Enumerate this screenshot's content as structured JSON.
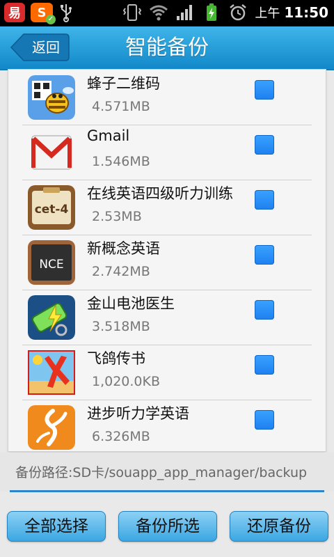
{
  "status_bar": {
    "left_icons": [
      "app-notification-icon",
      "sogou-input-icon",
      "usb-icon"
    ],
    "app1_glyph": "易",
    "app2_glyph": "S",
    "right_icons": [
      "vibrate-icon",
      "wifi-icon",
      "signal-icon",
      "battery-charging-icon",
      "alarm-icon"
    ],
    "ampm": "上午",
    "time": "11:50"
  },
  "header": {
    "back_label": "返回",
    "title": "智能备份"
  },
  "apps": [
    {
      "name": "蜂子二维码",
      "size": "4.571MB",
      "icon": "bee-qr-icon",
      "checked": true
    },
    {
      "name": "Gmail",
      "size": "1.546MB",
      "icon": "gmail-icon",
      "checked": true
    },
    {
      "name": "在线英语四级听力训练",
      "size": "2.53MB",
      "icon": "cet4-icon",
      "icon_text": "cet-4",
      "checked": true
    },
    {
      "name": "新概念英语",
      "size": "2.742MB",
      "icon": "nce-icon",
      "icon_text": "NCE",
      "checked": true
    },
    {
      "name": "金山电池医生",
      "size": "3.518MB",
      "icon": "battery-doctor-icon",
      "checked": true
    },
    {
      "name": "飞鸽传书",
      "size": "1,020.0KB",
      "icon": "feige-icon",
      "checked": true
    },
    {
      "name": "进步听力学英语",
      "size": "6.326MB",
      "icon": "jinbu-listening-icon",
      "checked": true
    }
  ],
  "backup_path": "备份路径:SD卡/souapp_app_manager/backup",
  "buttons": {
    "select_all": "全部选择",
    "backup_selected": "备份所选",
    "restore_backup": "还原备份"
  },
  "colors": {
    "title_bar": "#1e9ad9",
    "accent": "#2a86c8",
    "checkbox": "#1e80f0"
  }
}
